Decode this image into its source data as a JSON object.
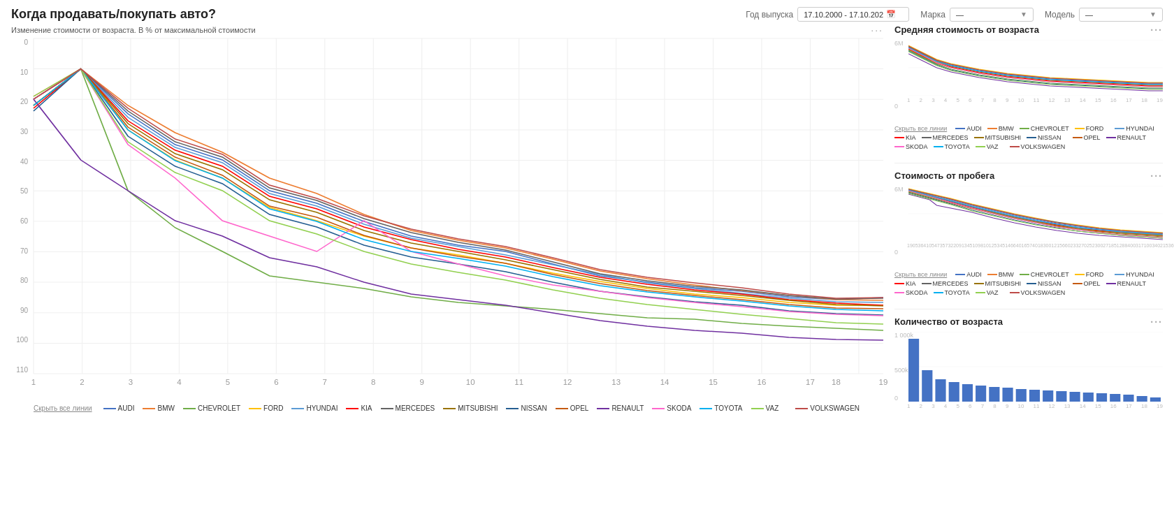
{
  "header": {
    "title": "Когда продавать/покупать авто?",
    "year_label": "Год выпуска",
    "year_value": "17.10.2000 - 17.10.202",
    "brand_label": "Марка",
    "brand_value": "—",
    "model_label": "Модель",
    "model_value": "—"
  },
  "main_chart": {
    "subtitle": "Изменение стоимости от возраста. В % от максимальной стоимости",
    "y_labels": [
      "0",
      "10",
      "20",
      "30",
      "40",
      "50",
      "60",
      "70",
      "80",
      "90",
      "100",
      "110"
    ],
    "x_labels": [
      "1",
      "2",
      "3",
      "4",
      "5",
      "6",
      "7",
      "8",
      "9",
      "10",
      "11",
      "12",
      "13",
      "14",
      "15",
      "16",
      "17",
      "18",
      "19"
    ],
    "legend_hide": "Скрыть все линии"
  },
  "legend_items": [
    {
      "label": "AUDI",
      "color": "#4472C4"
    },
    {
      "label": "BMW",
      "color": "#ED7D31"
    },
    {
      "label": "CHEVROLET",
      "color": "#70AD47"
    },
    {
      "label": "FORD",
      "color": "#FFC000"
    },
    {
      "label": "HYUNDAI",
      "color": "#5B9BD5"
    },
    {
      "label": "KIA",
      "color": "#FF0000"
    },
    {
      "label": "MERCEDES",
      "color": "#636363"
    },
    {
      "label": "MITSUBISHI",
      "color": "#997300"
    },
    {
      "label": "NISSAN",
      "color": "#255E91"
    },
    {
      "label": "OPEL",
      "color": "#C55A11"
    },
    {
      "label": "RENAULT",
      "color": "#7030A0"
    },
    {
      "label": "SKODA",
      "color": "#FF66CC"
    },
    {
      "label": "TOYOTA",
      "color": "#00B0F0"
    },
    {
      "label": "VAZ",
      "color": "#92D050"
    },
    {
      "label": "VOLKSWAGEN",
      "color": "#BE4B48"
    }
  ],
  "mini_charts": {
    "avg_cost": {
      "title": "Средняя стоимость от возраста",
      "y_max": "6M",
      "y_min": "0",
      "x_labels": [
        "1",
        "2",
        "3",
        "4",
        "5",
        "6",
        "7",
        "8",
        "9",
        "10",
        "11",
        "12",
        "13",
        "14",
        "15",
        "16",
        "17",
        "18",
        "19"
      ]
    },
    "cost_mileage": {
      "title": "Стоимость от пробега",
      "y_max": "6M",
      "y_min": "0"
    },
    "count_age": {
      "title": "Количество от возраста",
      "y_max": "1 000k",
      "y_mid": "500k",
      "y_min": "0",
      "x_labels": [
        "1",
        "2",
        "3",
        "4",
        "5",
        "6",
        "7",
        "8",
        "9",
        "10",
        "11",
        "12",
        "13",
        "14",
        "15",
        "16",
        "17",
        "18",
        "19"
      ]
    }
  },
  "mini_legend_hide": "Скрыть все линии"
}
